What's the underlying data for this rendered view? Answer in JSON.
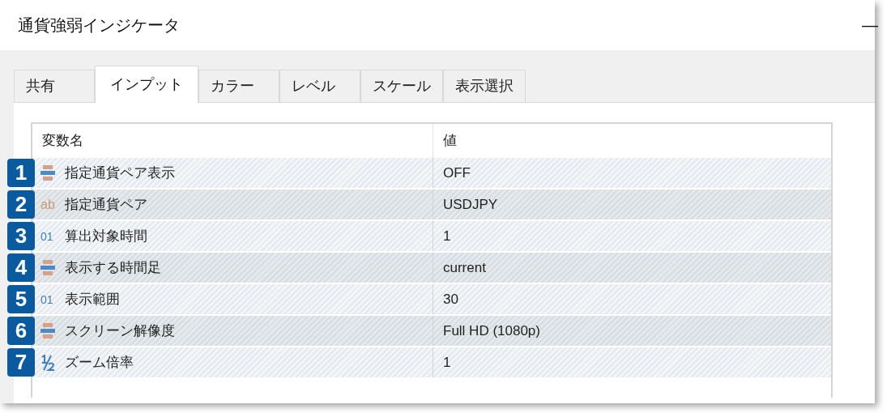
{
  "window": {
    "title": "通貨強弱インジケータ",
    "minimize": "—"
  },
  "tabs": [
    {
      "label": "共有",
      "selected": false
    },
    {
      "label": "インプット",
      "selected": true
    },
    {
      "label": "カラー",
      "selected": false
    },
    {
      "label": "レベル",
      "selected": false
    },
    {
      "label": "スケール",
      "selected": false
    },
    {
      "label": "表示選択",
      "selected": false
    }
  ],
  "table": {
    "columns": [
      "変数名",
      "値"
    ],
    "rows": [
      {
        "badge": "1",
        "kind": "enum",
        "name": "指定通貨ペア表示",
        "value": "OFF"
      },
      {
        "badge": "2",
        "kind": "string",
        "icon_text": "ab",
        "name": "指定通貨ペア",
        "value": "USDJPY"
      },
      {
        "badge": "3",
        "kind": "int",
        "icon_text": "01",
        "name": "算出対象時間",
        "value": "1"
      },
      {
        "badge": "4",
        "kind": "enum",
        "name": "表示する時間足",
        "value": "current"
      },
      {
        "badge": "5",
        "kind": "int",
        "icon_text": "01",
        "name": "表示範囲",
        "value": "30"
      },
      {
        "badge": "6",
        "kind": "enum",
        "name": "スクリーン解像度",
        "value": "Full HD (1080p)"
      },
      {
        "badge": "7",
        "kind": "double",
        "name": "ズーム倍率",
        "value": "1"
      }
    ]
  }
}
